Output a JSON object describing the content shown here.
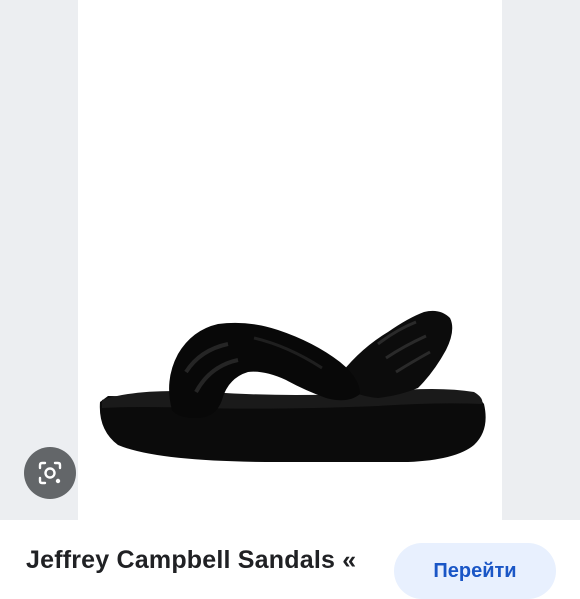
{
  "result": {
    "title": "Jeffrey Campbell Sandals «",
    "visit_label": "Перейти"
  },
  "image": {
    "subject": "black velvet slingback platform sandal"
  },
  "icons": {
    "lens": "google-lens-icon"
  }
}
